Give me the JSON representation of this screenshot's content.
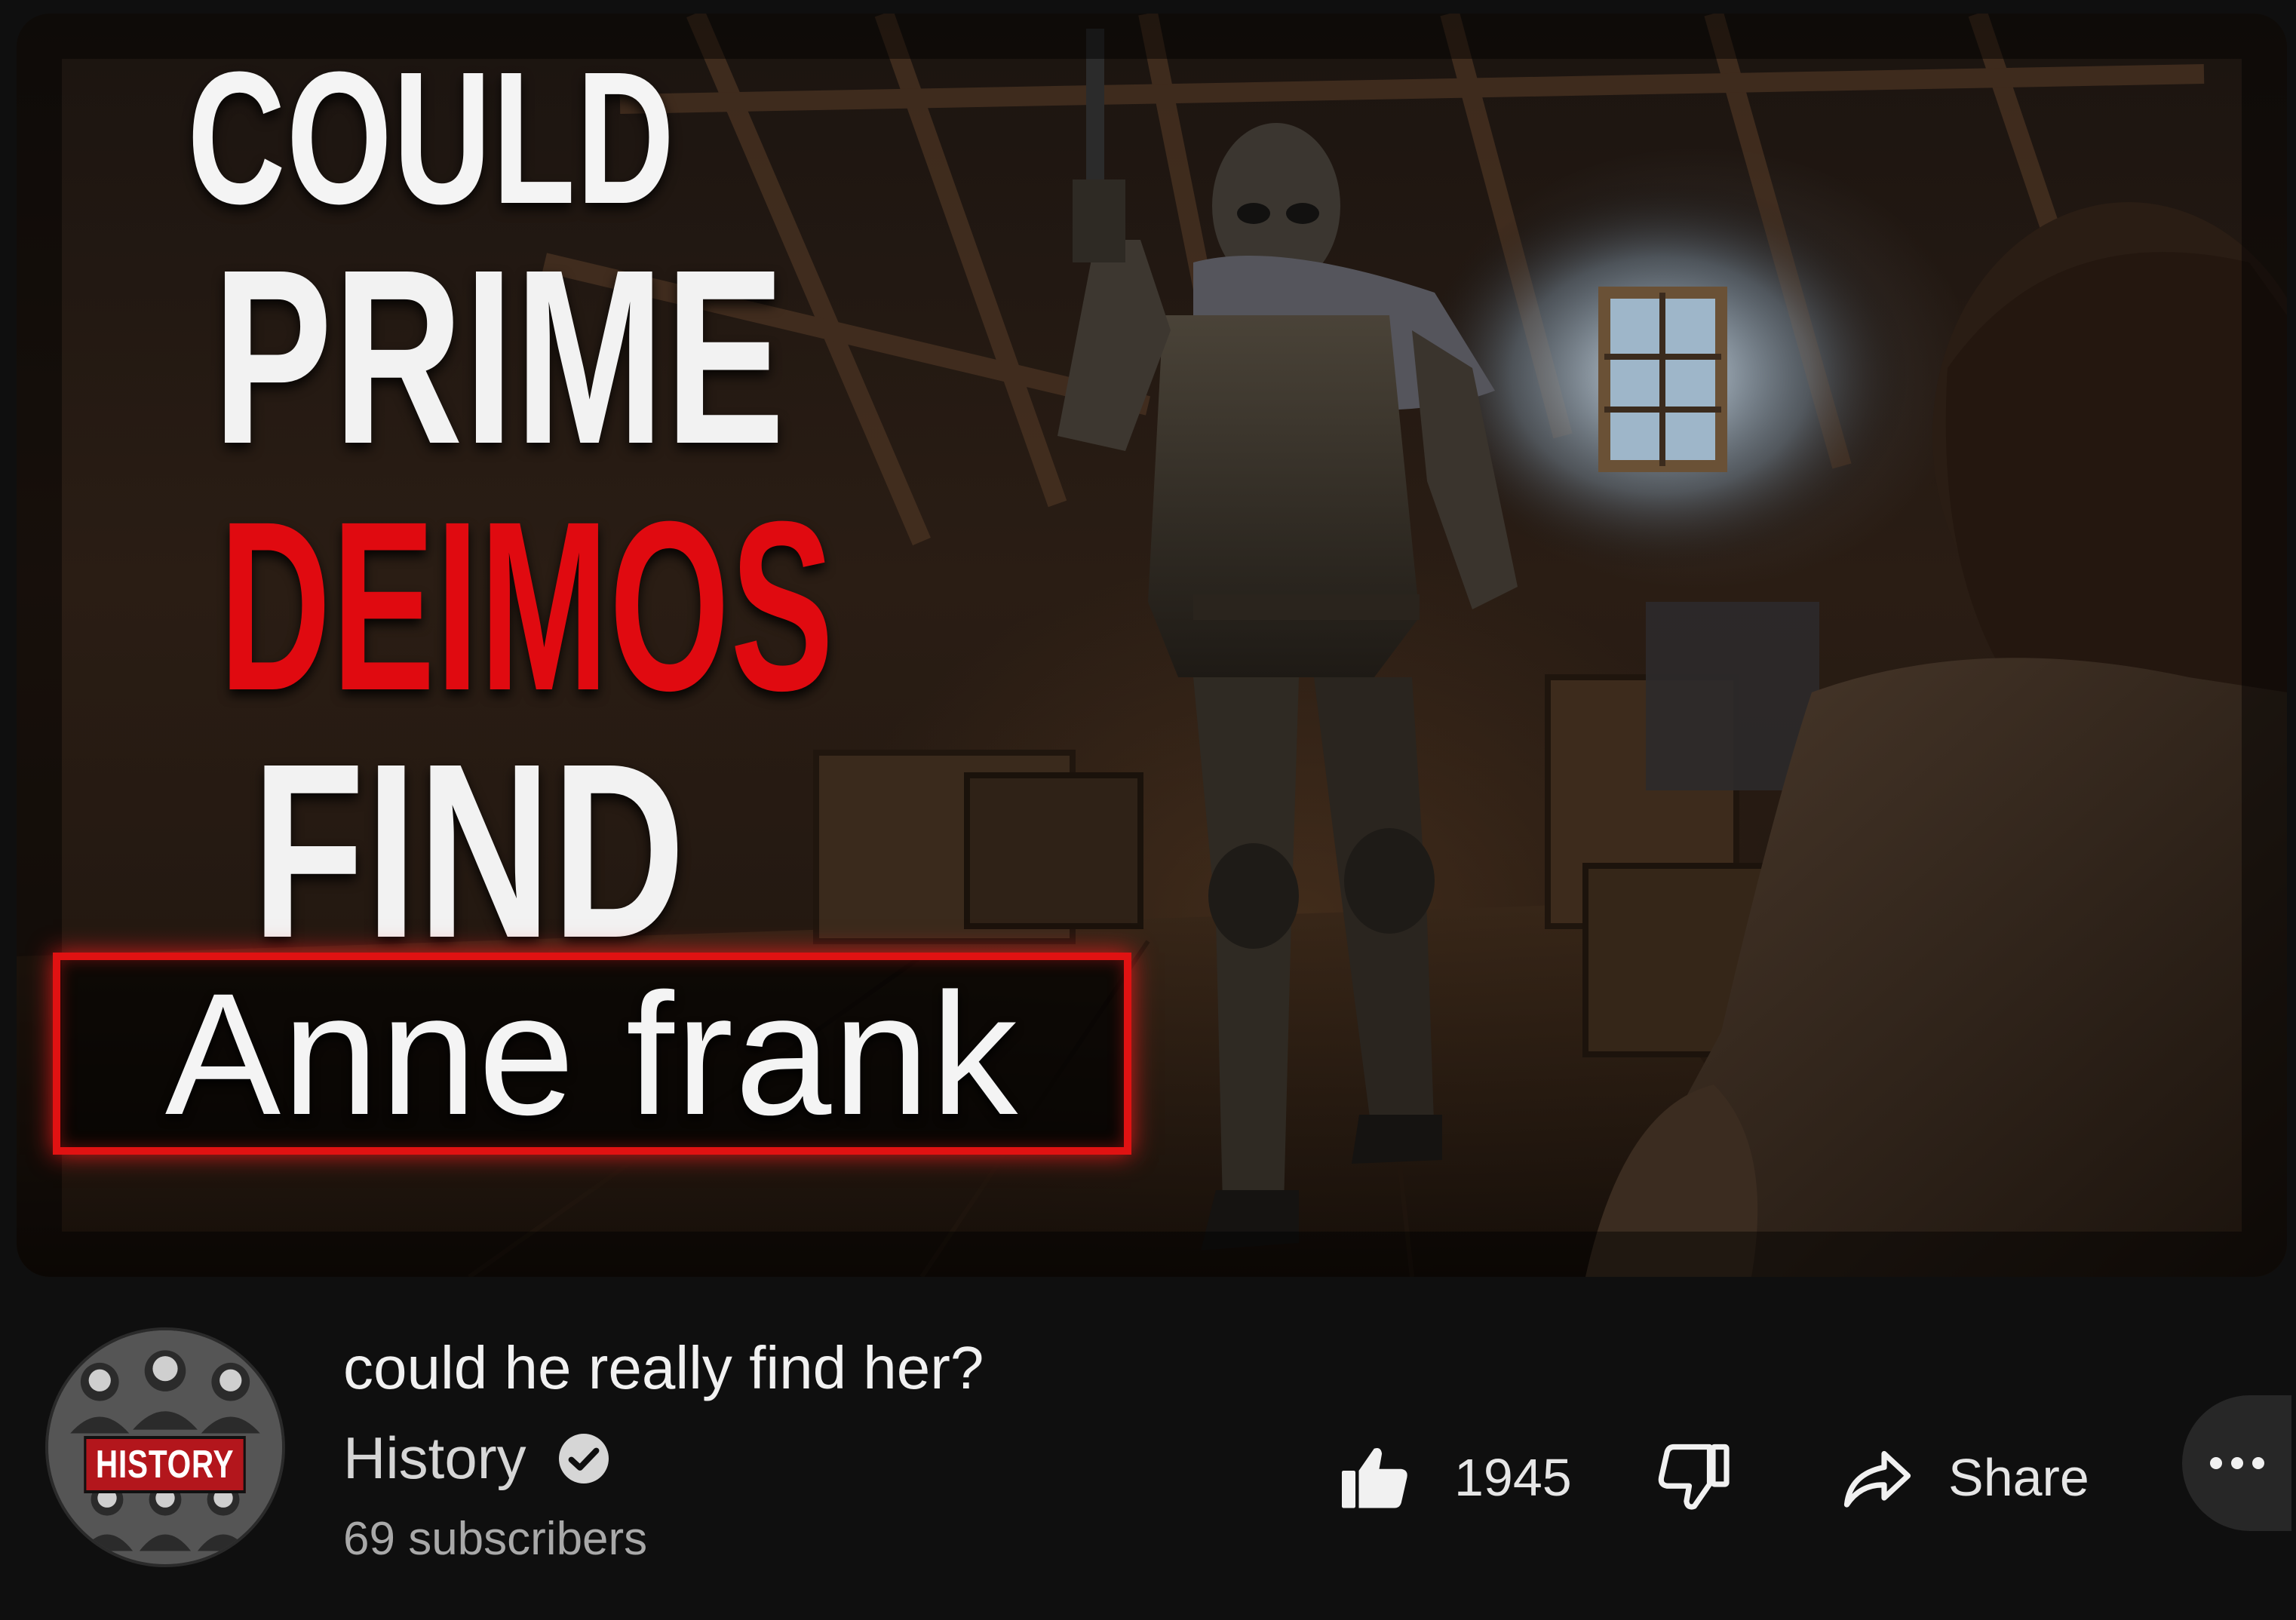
{
  "thumbnail": {
    "headline": {
      "line1": "COULD",
      "line2": "PRIME",
      "line3": "DEIMOS",
      "line4": "FIND"
    },
    "name_label": "Anne frank",
    "accent_red": "#e00a10",
    "text_white": "#f4f4f4"
  },
  "video": {
    "title": "could he really find her?"
  },
  "channel": {
    "avatar_label": "HISTORY",
    "name": "History",
    "verified_icon": "verified-check-icon",
    "subscribers": "69 subscribers"
  },
  "actions": {
    "like_icon": "thumbs-up-icon",
    "like_count": "1945",
    "dislike_icon": "thumbs-down-icon",
    "share_icon": "share-arrow-icon",
    "share_label": "Share",
    "more_icon": "more-horizontal-icon"
  },
  "colors": {
    "page_background": "#0f0f0f",
    "button_background": "#272727"
  }
}
